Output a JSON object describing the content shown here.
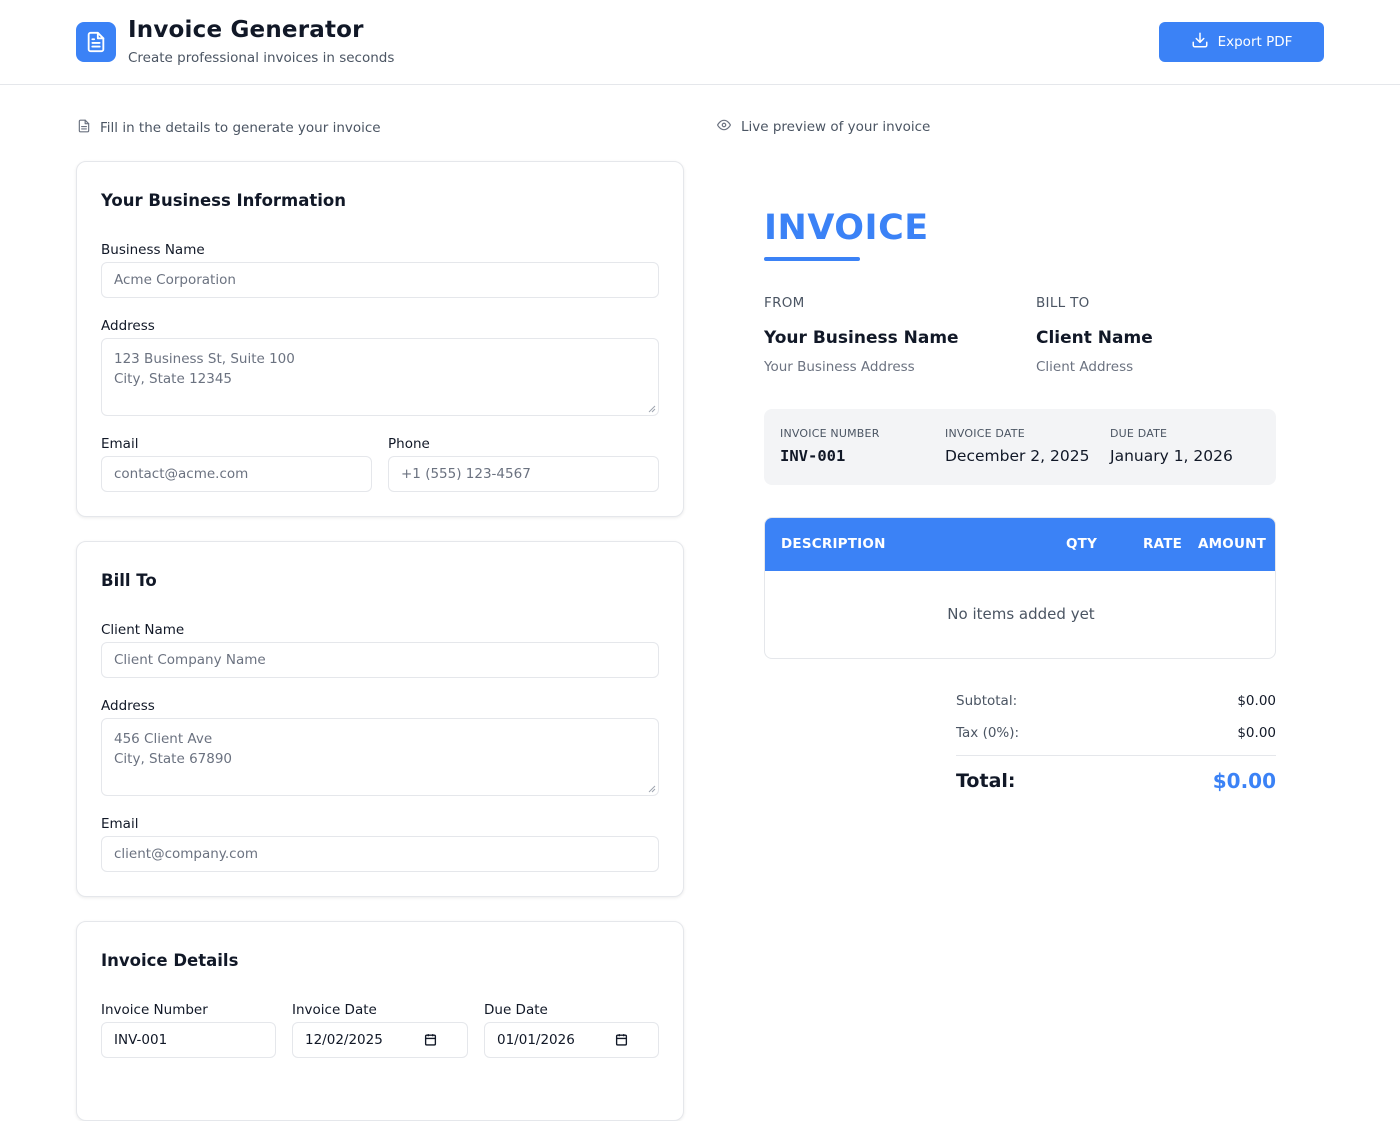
{
  "header": {
    "title": "Invoice Generator",
    "subtitle": "Create professional invoices in seconds",
    "export_label": "Export PDF"
  },
  "form_caption": "Fill in the details to generate your invoice",
  "preview_caption": "Live preview of your invoice",
  "business": {
    "heading": "Your Business Information",
    "name_label": "Business Name",
    "name_placeholder": "Acme Corporation",
    "address_label": "Address",
    "address_line1": "123 Business St, Suite 100",
    "address_line2": "City, State 12345",
    "email_label": "Email",
    "email_placeholder": "contact@acme.com",
    "phone_label": "Phone",
    "phone_placeholder": "+1 (555) 123-4567"
  },
  "bill_to": {
    "heading": "Bill To",
    "name_label": "Client Name",
    "name_placeholder": "Client Company Name",
    "address_label": "Address",
    "address_line1": "456 Client Ave",
    "address_line2": "City, State 67890",
    "email_label": "Email",
    "email_placeholder": "client@company.com"
  },
  "details": {
    "heading": "Invoice Details",
    "number_label": "Invoice Number",
    "number_value": "INV-001",
    "date_label": "Invoice Date",
    "date_value": "12/02/2025",
    "due_label": "Due Date",
    "due_value": "01/01/2026"
  },
  "preview": {
    "title": "INVOICE",
    "from_label": "FROM",
    "from_name": "Your Business Name",
    "from_address": "Your Business Address",
    "bill_label": "BILL TO",
    "bill_name": "Client Name",
    "bill_address": "Client Address",
    "meta": {
      "number_label": "INVOICE NUMBER",
      "number_value": "INV-001",
      "date_label": "INVOICE DATE",
      "date_value": "December 2, 2025",
      "due_label": "DUE DATE",
      "due_value": "January 1, 2026"
    },
    "table": {
      "columns": [
        "DESCRIPTION",
        "QTY",
        "RATE",
        "AMOUNT"
      ],
      "empty_message": "No items added yet"
    },
    "totals": {
      "subtotal_label": "Subtotal:",
      "subtotal_value": "$0.00",
      "tax_label": "Tax (0%):",
      "tax_value": "$0.00",
      "total_label": "Total:",
      "total_value": "$0.00"
    }
  },
  "colors": {
    "accent": "#3b82f6",
    "text": "#111827",
    "muted": "#6b7280",
    "border": "#e5e7eb"
  },
  "icons": {
    "logo": "document-icon",
    "export": "download-icon",
    "form_caption": "document-icon",
    "preview_caption": "eye-icon",
    "date": "calendar-icon"
  }
}
